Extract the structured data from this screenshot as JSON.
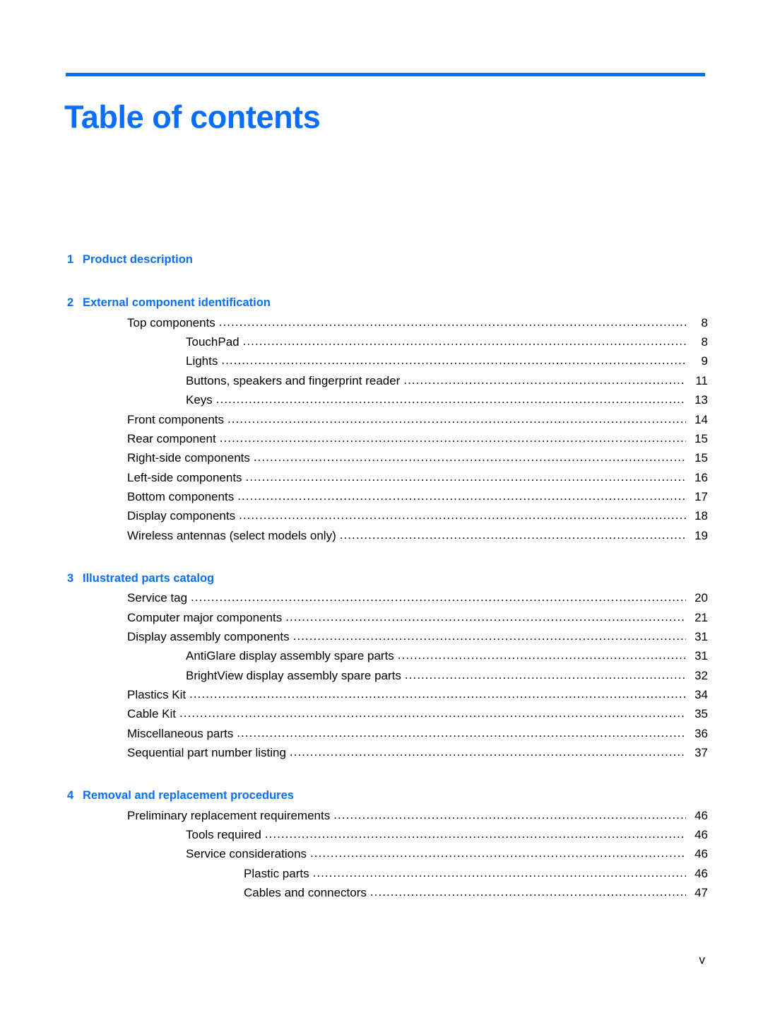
{
  "document": {
    "title": "Table of contents",
    "accent_color": "#0a6efd",
    "footer_page_label": "v"
  },
  "toc": {
    "chapters": [
      {
        "number": "1",
        "title": "Product description",
        "entries": []
      },
      {
        "number": "2",
        "title": "External component identification",
        "entries": [
          {
            "level": 1,
            "label": "Top components",
            "page": "8"
          },
          {
            "level": 2,
            "label": "TouchPad",
            "page": "8"
          },
          {
            "level": 2,
            "label": "Lights",
            "page": "9"
          },
          {
            "level": 2,
            "label": "Buttons, speakers and fingerprint reader",
            "page": "11"
          },
          {
            "level": 2,
            "label": "Keys",
            "page": "13"
          },
          {
            "level": 1,
            "label": "Front components",
            "page": "14"
          },
          {
            "level": 1,
            "label": "Rear component",
            "page": "15"
          },
          {
            "level": 1,
            "label": "Right-side components",
            "page": "15"
          },
          {
            "level": 1,
            "label": "Left-side components",
            "page": "16"
          },
          {
            "level": 1,
            "label": "Bottom components",
            "page": "17"
          },
          {
            "level": 1,
            "label": "Display components",
            "page": "18"
          },
          {
            "level": 1,
            "label": "Wireless antennas (select models only)",
            "page": "19"
          }
        ]
      },
      {
        "number": "3",
        "title": "Illustrated parts catalog",
        "entries": [
          {
            "level": 1,
            "label": "Service tag",
            "page": "20"
          },
          {
            "level": 1,
            "label": "Computer major components",
            "page": "21"
          },
          {
            "level": 1,
            "label": "Display assembly components",
            "page": "31"
          },
          {
            "level": 2,
            "label": "AntiGlare display assembly spare parts",
            "page": "31"
          },
          {
            "level": 2,
            "label": "BrightView display assembly spare parts",
            "page": "32"
          },
          {
            "level": 1,
            "label": "Plastics Kit",
            "page": "34"
          },
          {
            "level": 1,
            "label": "Cable Kit",
            "page": "35"
          },
          {
            "level": 1,
            "label": "Miscellaneous parts",
            "page": "36"
          },
          {
            "level": 1,
            "label": "Sequential part number listing",
            "page": "37"
          }
        ]
      },
      {
        "number": "4",
        "title": "Removal and replacement procedures",
        "entries": [
          {
            "level": 1,
            "label": "Preliminary replacement requirements",
            "page": "46"
          },
          {
            "level": 2,
            "label": "Tools required",
            "page": "46"
          },
          {
            "level": 2,
            "label": "Service considerations",
            "page": "46"
          },
          {
            "level": 3,
            "label": "Plastic parts",
            "page": "46"
          },
          {
            "level": 3,
            "label": "Cables and connectors",
            "page": "47"
          }
        ]
      }
    ]
  }
}
